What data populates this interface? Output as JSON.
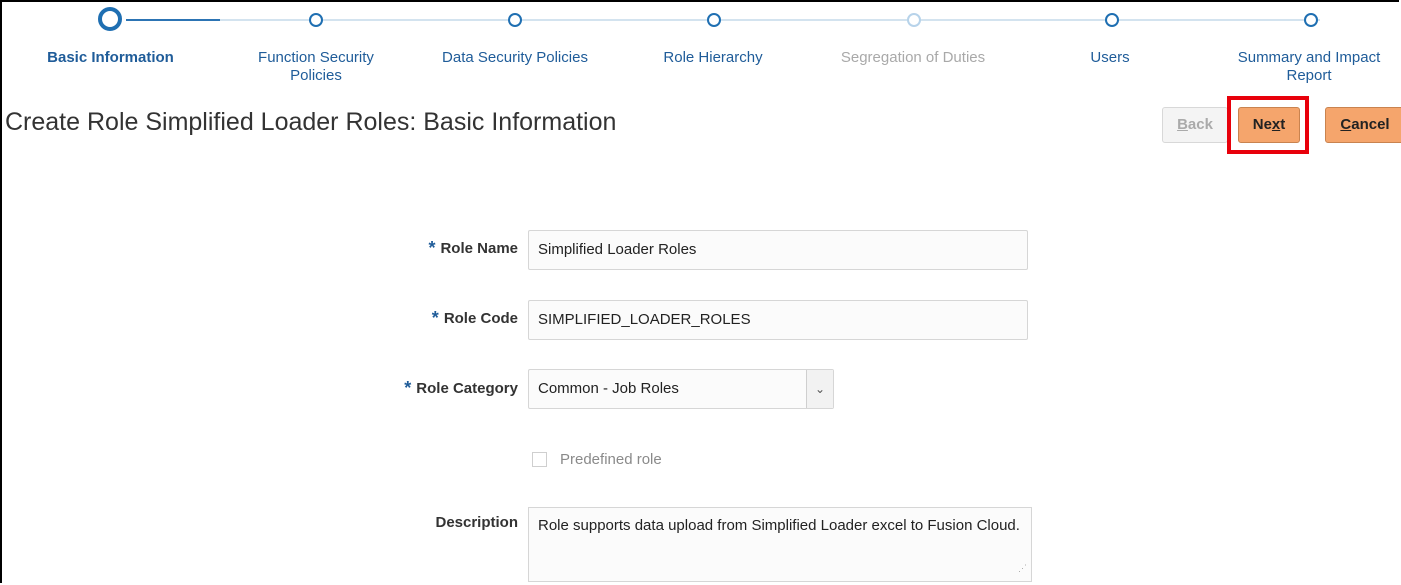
{
  "train": {
    "steps": [
      {
        "label_lines": [
          "Basic Information"
        ],
        "state": "current"
      },
      {
        "label_lines": [
          "Function Security",
          "Policies"
        ],
        "state": "normal"
      },
      {
        "label_lines": [
          "Data Security Policies"
        ],
        "state": "normal"
      },
      {
        "label_lines": [
          "Role Hierarchy"
        ],
        "state": "normal"
      },
      {
        "label_lines": [
          "Segregation of Duties"
        ],
        "state": "disabled"
      },
      {
        "label_lines": [
          "Users"
        ],
        "state": "normal"
      },
      {
        "label_lines": [
          "Summary and Impact",
          "Report"
        ],
        "state": "normal"
      }
    ]
  },
  "page": {
    "title": "Create Role Simplified Loader Roles: Basic Information"
  },
  "toolbar": {
    "back_pre": "B",
    "back_mnemonic": "",
    "back_post": "ack",
    "back_first": "B",
    "next_pre": "Ne",
    "next_mnemonic": "x",
    "next_post": "t",
    "cancel_mnemonic": "C",
    "cancel_post": "ancel"
  },
  "form": {
    "required_marker": "*",
    "role_name_label": "Role Name",
    "role_name_value": "Simplified Loader Roles",
    "role_code_label": "Role Code",
    "role_code_value": "SIMPLIFIED_LOADER_ROLES",
    "role_category_label": "Role Category",
    "role_category_value": "Common - Job Roles",
    "predefined_label": "Predefined role",
    "description_label": "Description",
    "description_value": "Role supports data upload from Simplified Loader excel to Fusion Cloud."
  },
  "colors": {
    "accent": "#1f6fb2",
    "button_primary": "#f5a56c",
    "highlight_box": "#e8000b"
  }
}
